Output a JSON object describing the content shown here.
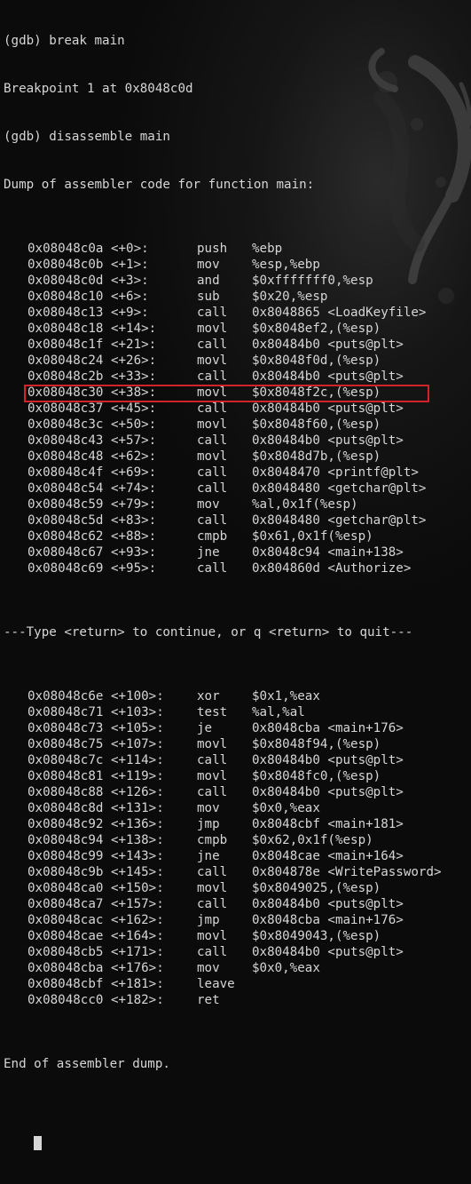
{
  "terminal": {
    "header_lines": [
      "(gdb) break main",
      "Breakpoint 1 at 0x8048c0d",
      "(gdb) disassemble main",
      "Dump of assembler code for function main:"
    ],
    "instructions_before": [
      {
        "addr": "0x08048c0a <+0>:",
        "mnemonic": "push",
        "operands": "%ebp"
      },
      {
        "addr": "0x08048c0b <+1>:",
        "mnemonic": "mov",
        "operands": "%esp,%ebp"
      },
      {
        "addr": "0x08048c0d <+3>:",
        "mnemonic": "and",
        "operands": "$0xfffffff0,%esp"
      },
      {
        "addr": "0x08048c10 <+6>:",
        "mnemonic": "sub",
        "operands": "$0x20,%esp"
      },
      {
        "addr": "0x08048c13 <+9>:",
        "mnemonic": "call",
        "operands": "0x8048865 <LoadKeyfile>"
      },
      {
        "addr": "0x08048c18 <+14>:",
        "mnemonic": "movl",
        "operands": "$0x8048ef2,(%esp)"
      },
      {
        "addr": "0x08048c1f <+21>:",
        "mnemonic": "call",
        "operands": "0x80484b0 <puts@plt>"
      },
      {
        "addr": "0x08048c24 <+26>:",
        "mnemonic": "movl",
        "operands": "$0x8048f0d,(%esp)"
      },
      {
        "addr": "0x08048c2b <+33>:",
        "mnemonic": "call",
        "operands": "0x80484b0 <puts@plt>"
      },
      {
        "addr": "0x08048c30 <+38>:",
        "mnemonic": "movl",
        "operands": "$0x8048f2c,(%esp)"
      },
      {
        "addr": "0x08048c37 <+45>:",
        "mnemonic": "call",
        "operands": "0x80484b0 <puts@plt>"
      },
      {
        "addr": "0x08048c3c <+50>:",
        "mnemonic": "movl",
        "operands": "$0x8048f60,(%esp)"
      },
      {
        "addr": "0x08048c43 <+57>:",
        "mnemonic": "call",
        "operands": "0x80484b0 <puts@plt>"
      },
      {
        "addr": "0x08048c48 <+62>:",
        "mnemonic": "movl",
        "operands": "$0x8048d7b,(%esp)"
      },
      {
        "addr": "0x08048c4f <+69>:",
        "mnemonic": "call",
        "operands": "0x8048470 <printf@plt>"
      },
      {
        "addr": "0x08048c54 <+74>:",
        "mnemonic": "call",
        "operands": "0x8048480 <getchar@plt>"
      },
      {
        "addr": "0x08048c59 <+79>:",
        "mnemonic": "mov",
        "operands": "%al,0x1f(%esp)"
      },
      {
        "addr": "0x08048c5d <+83>:",
        "mnemonic": "call",
        "operands": "0x8048480 <getchar@plt>"
      },
      {
        "addr": "0x08048c62 <+88>:",
        "mnemonic": "cmpb",
        "operands": "$0x61,0x1f(%esp)"
      },
      {
        "addr": "0x08048c67 <+93>:",
        "mnemonic": "jne",
        "operands": "0x8048c94 <main+138>"
      },
      {
        "addr": "0x08048c69 <+95>:",
        "mnemonic": "call",
        "operands": "0x804860d <Authorize>"
      }
    ],
    "pager_prompt": "---Type <return> to continue, or q <return> to quit---",
    "instructions_after": [
      {
        "addr": "0x08048c6e <+100>:",
        "mnemonic": "xor",
        "operands": "$0x1,%eax"
      },
      {
        "addr": "0x08048c71 <+103>:",
        "mnemonic": "test",
        "operands": "%al,%al"
      },
      {
        "addr": "0x08048c73 <+105>:",
        "mnemonic": "je",
        "operands": "0x8048cba <main+176>"
      },
      {
        "addr": "0x08048c75 <+107>:",
        "mnemonic": "movl",
        "operands": "$0x8048f94,(%esp)"
      },
      {
        "addr": "0x08048c7c <+114>:",
        "mnemonic": "call",
        "operands": "0x80484b0 <puts@plt>"
      },
      {
        "addr": "0x08048c81 <+119>:",
        "mnemonic": "movl",
        "operands": "$0x8048fc0,(%esp)"
      },
      {
        "addr": "0x08048c88 <+126>:",
        "mnemonic": "call",
        "operands": "0x80484b0 <puts@plt>"
      },
      {
        "addr": "0x08048c8d <+131>:",
        "mnemonic": "mov",
        "operands": "$0x0,%eax"
      },
      {
        "addr": "0x08048c92 <+136>:",
        "mnemonic": "jmp",
        "operands": "0x8048cbf <main+181>"
      },
      {
        "addr": "0x08048c94 <+138>:",
        "mnemonic": "cmpb",
        "operands": "$0x62,0x1f(%esp)"
      },
      {
        "addr": "0x08048c99 <+143>:",
        "mnemonic": "jne",
        "operands": "0x8048cae <main+164>"
      },
      {
        "addr": "0x08048c9b <+145>:",
        "mnemonic": "call",
        "operands": "0x804878e <WritePassword>"
      },
      {
        "addr": "0x08048ca0 <+150>:",
        "mnemonic": "movl",
        "operands": "$0x8049025,(%esp)"
      },
      {
        "addr": "0x08048ca7 <+157>:",
        "mnemonic": "call",
        "operands": "0x80484b0 <puts@plt>"
      },
      {
        "addr": "0x08048cac <+162>:",
        "mnemonic": "jmp",
        "operands": "0x8048cba <main+176>"
      },
      {
        "addr": "0x08048cae <+164>:",
        "mnemonic": "movl",
        "operands": "$0x8049043,(%esp)"
      },
      {
        "addr": "0x08048cb5 <+171>:",
        "mnemonic": "call",
        "operands": "0x80484b0 <puts@plt>"
      },
      {
        "addr": "0x08048cba <+176>:",
        "mnemonic": "mov",
        "operands": "$0x0,%eax"
      },
      {
        "addr": "0x08048cbf <+181>:",
        "mnemonic": "leave",
        "operands": ""
      },
      {
        "addr": "0x08048cc0 <+182>:",
        "mnemonic": "ret",
        "operands": ""
      }
    ],
    "footer_lines": [
      "End of assembler dump."
    ]
  },
  "colors": {
    "background": "#0b0b0b",
    "text": "#d6d6d6",
    "highlight_border": "#d0232a"
  },
  "icons": {
    "background_logo": "swirl-logo-watermark"
  }
}
